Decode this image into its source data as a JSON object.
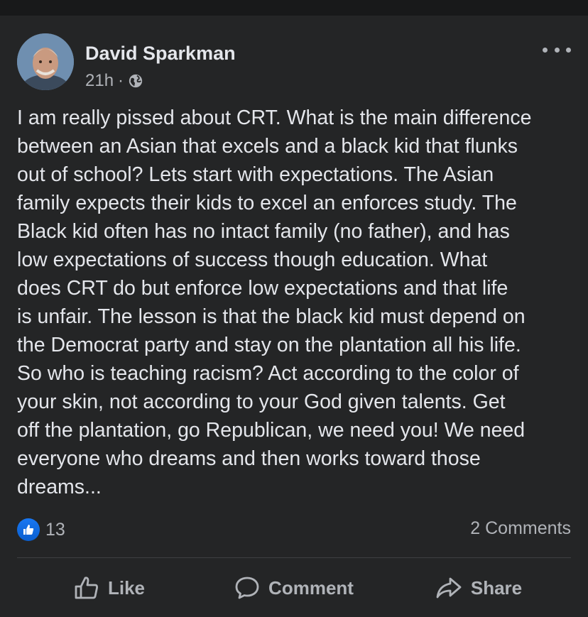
{
  "post": {
    "author": "David Sparkman",
    "time": "21h",
    "separator": "·",
    "privacy_icon": "globe-icon",
    "more_icon": "more-options-icon",
    "body": "I am really pissed about CRT. What is the main difference\nbetween an Asian that excels and a black kid that flunks\nout of school? Lets start with expectations. The Asian\nfamily expects their kids to excel an enforces study. The\nBlack kid often has no intact family (no father), and has\nlow expectations of success though education. What\ndoes CRT do but enforce low expectations and that life\nis unfair. The lesson is that the black kid must depend on\nthe Democrat party and stay on the plantation all his life.\nSo who is teaching racism? Act according to the color of\nyour skin, not according to your God given talents. Get\noff the plantation, go Republican, we need you! We need\neveryone who dreams and then works toward those\ndreams...",
    "reaction_count": "13",
    "comments_count": "2 Comments"
  },
  "actions": {
    "like": "Like",
    "comment": "Comment",
    "share": "Share"
  },
  "colors": {
    "background": "#242526",
    "text": "#e4e6eb",
    "secondary_text": "#b0b3b8",
    "like_blue": "#1877f2"
  }
}
